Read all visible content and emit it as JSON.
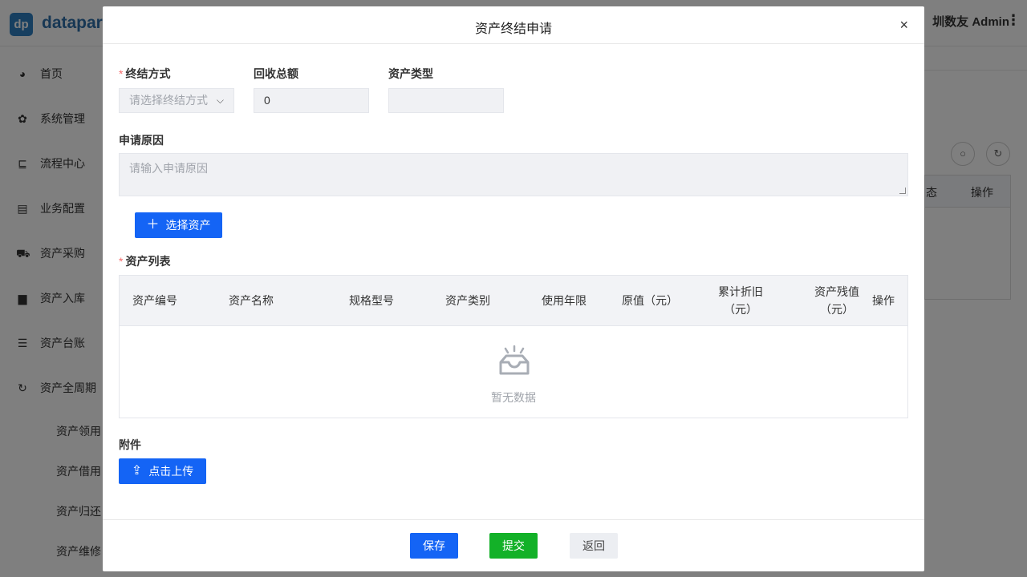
{
  "app": {
    "logo_letters": "dp",
    "logo_text": "datapart",
    "user_label": "圳数友 Admin",
    "more_icon": "⋮"
  },
  "sidebar": {
    "items": [
      {
        "label": "首页",
        "icon": "dashboard-icon"
      },
      {
        "label": "系统管理",
        "icon": "gear-icon"
      },
      {
        "label": "流程中心",
        "icon": "flow-icon"
      },
      {
        "label": "业务配置",
        "icon": "config-icon"
      },
      {
        "label": "资产采购",
        "icon": "cart-icon"
      },
      {
        "label": "资产入库",
        "icon": "box-icon"
      },
      {
        "label": "资产台账",
        "icon": "list-icon"
      },
      {
        "label": "资产全周期",
        "icon": "cycle-icon"
      }
    ],
    "sub_items": [
      "资产领用",
      "资产借用",
      "资产归还",
      "资产维修"
    ]
  },
  "background": {
    "table_headers": [
      "态",
      "操作"
    ]
  },
  "dialog": {
    "title": "资产终结申请",
    "close_symbol": "×",
    "fields": {
      "method": {
        "label": "终结方式",
        "placeholder": "请选择终结方式",
        "required": true
      },
      "total": {
        "label": "回收总额",
        "value": "0"
      },
      "type": {
        "label": "资产类型",
        "value": ""
      }
    },
    "reason": {
      "label": "申请原因",
      "placeholder": "请输入申请原因"
    },
    "select_asset_button": "选择资产",
    "asset_list": {
      "label": "资产列表",
      "required": true,
      "headers": [
        "资产编号",
        "资产名称",
        "规格型号",
        "资产类别",
        "使用年限",
        "原值（元）",
        "累计折旧（元）",
        "资产残值（元）",
        "操作"
      ],
      "empty_text": "暂无数据"
    },
    "attachment": {
      "label": "附件",
      "upload_button": "点击上传"
    },
    "footer": {
      "save": "保存",
      "submit": "提交",
      "back": "返回"
    }
  },
  "colors": {
    "primary": "#1464f5",
    "success": "#13b128",
    "required": "#f56c6c"
  }
}
